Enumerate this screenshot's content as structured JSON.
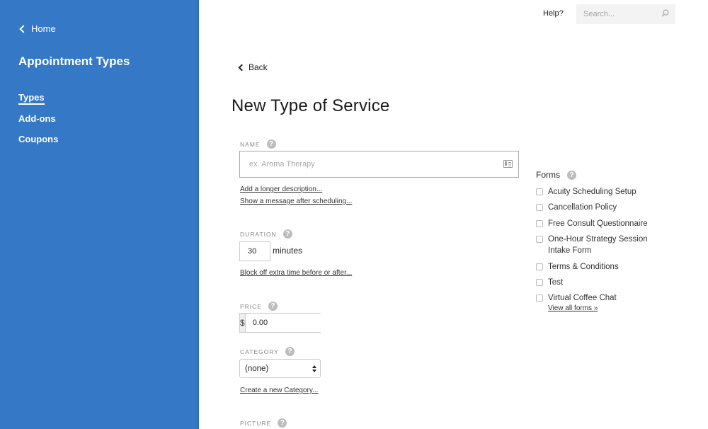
{
  "sidebar": {
    "home_label": "Home",
    "title": "Appointment Types",
    "nav": [
      {
        "label": "Types",
        "active": true
      },
      {
        "label": "Add-ons",
        "active": false
      },
      {
        "label": "Coupons",
        "active": false
      }
    ],
    "color": "#3478c6"
  },
  "header": {
    "help_label": "Help?",
    "search_placeholder": "Search..."
  },
  "main": {
    "back_label": "Back",
    "title": "New Type of Service",
    "name": {
      "label": "NAME",
      "placeholder": "ex. Aroma Therapy",
      "value": "",
      "links": [
        "Add a longer description...",
        "Show a message after scheduling..."
      ]
    },
    "duration": {
      "label": "DURATION",
      "value": "30",
      "unit": "minutes",
      "link": "Block off extra time before or after..."
    },
    "price": {
      "label": "PRICE",
      "currency": "$",
      "value": "0.00"
    },
    "category": {
      "label": "CATEGORY",
      "selected": "(none)",
      "link": "Create a new Category..."
    },
    "picture": {
      "label": "PICTURE"
    }
  },
  "forms": {
    "title": "Forms",
    "items": [
      {
        "label": "Acuity Scheduling Setup",
        "checked": false
      },
      {
        "label": "Cancellation Policy",
        "checked": false
      },
      {
        "label": "Free Consult Questionnaire",
        "checked": false
      },
      {
        "label": "One-Hour Strategy Session Intake Form",
        "checked": false
      },
      {
        "label": "Terms & Conditions",
        "checked": false
      },
      {
        "label": "Test",
        "checked": false
      },
      {
        "label": "Virtual Coffee Chat",
        "checked": false
      }
    ],
    "view_all_label": "View all forms »"
  },
  "help_icon_glyph": "?"
}
